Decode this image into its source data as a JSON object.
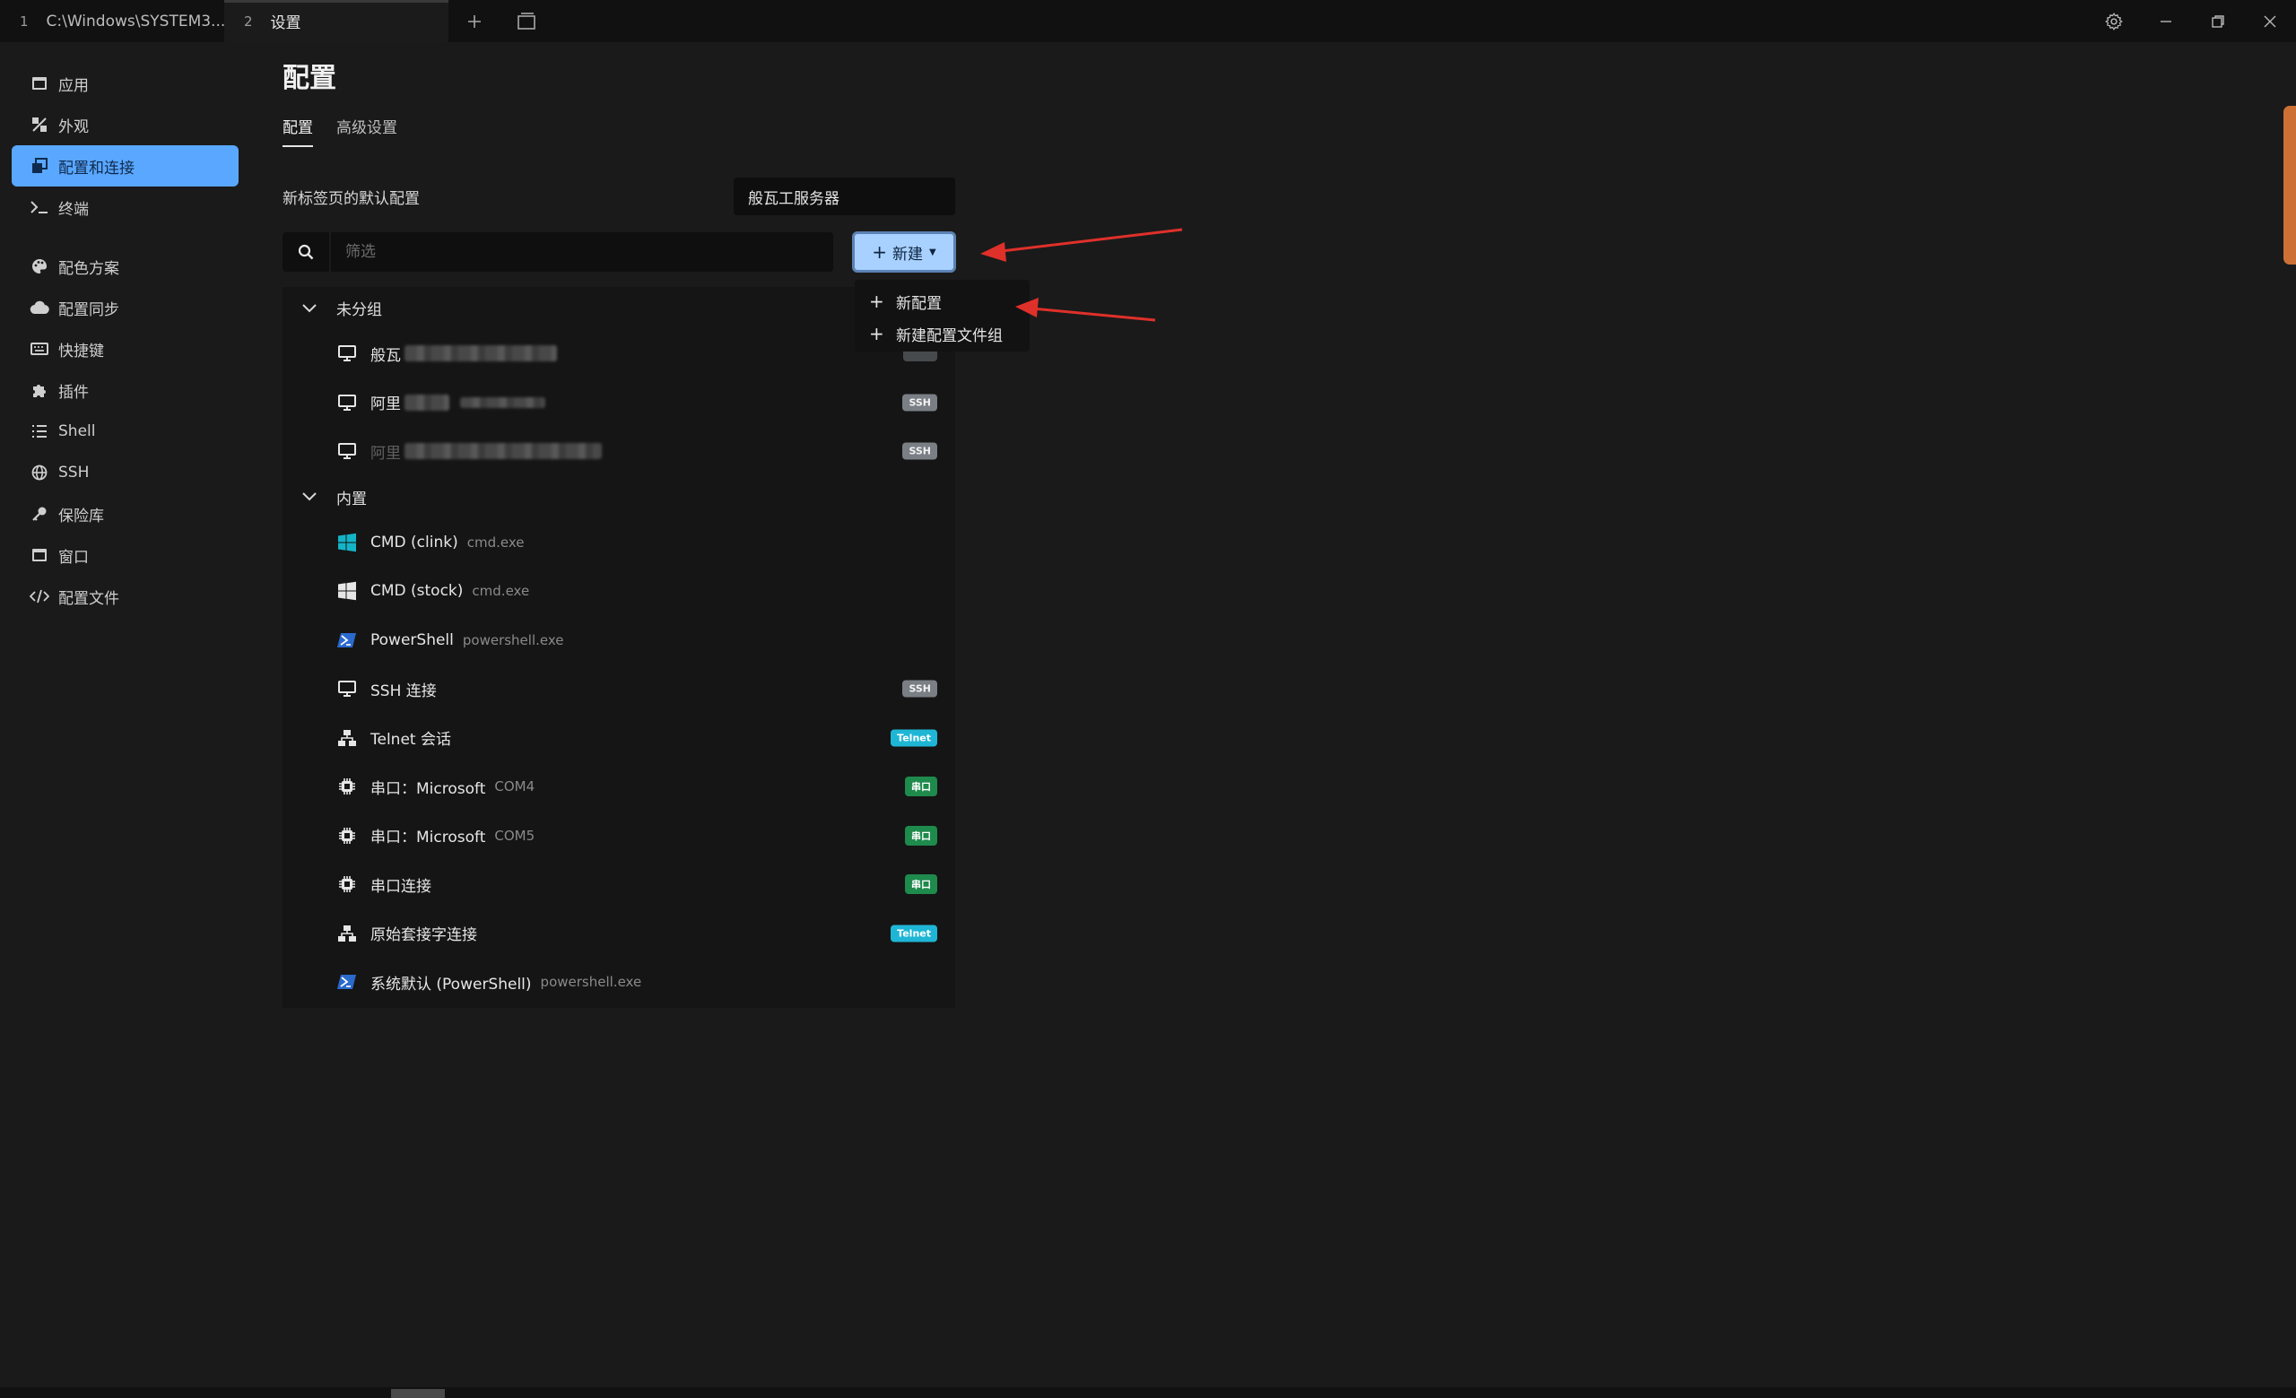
{
  "tabs": [
    {
      "num": "1",
      "label": "C:\\Windows\\SYSTEM3..."
    },
    {
      "num": "2",
      "label": "设置"
    }
  ],
  "sidebar": {
    "items": [
      {
        "label": "应用",
        "icon": "window-icon"
      },
      {
        "label": "外观",
        "icon": "appearance-icon"
      },
      {
        "label": "配置和连接",
        "icon": "profiles-icon"
      },
      {
        "label": "终端",
        "icon": "terminal-icon"
      },
      {
        "label": "配色方案",
        "icon": "palette-icon"
      },
      {
        "label": "配置同步",
        "icon": "cloud-icon"
      },
      {
        "label": "快捷键",
        "icon": "keyboard-icon"
      },
      {
        "label": "插件",
        "icon": "puzzle-icon"
      },
      {
        "label": "Shell",
        "icon": "list-icon"
      },
      {
        "label": "SSH",
        "icon": "globe-icon"
      },
      {
        "label": "保险库",
        "icon": "key-icon"
      },
      {
        "label": "窗口",
        "icon": "window-icon"
      },
      {
        "label": "配置文件",
        "icon": "code-icon"
      }
    ]
  },
  "main": {
    "title": "配置",
    "subtabs": [
      "配置",
      "高级设置"
    ],
    "default_label": "新标签页的默认配置",
    "default_value": "般瓦工服务器",
    "filter_placeholder": "筛选",
    "new_button": "新建",
    "dropdown": [
      "新配置",
      "新建配置文件组"
    ]
  },
  "groups": [
    {
      "title": "未分组",
      "items": [
        {
          "name": "般瓦",
          "cmd": "",
          "badge": "",
          "badge_type": "ssh",
          "icon": "monitor-icon"
        },
        {
          "name": "阿里",
          "cmd": "",
          "badge": "SSH",
          "badge_type": "ssh",
          "icon": "monitor-icon"
        },
        {
          "name": "阿里",
          "cmd": "",
          "badge": "SSH",
          "badge_type": "ssh",
          "icon": "monitor-icon"
        }
      ]
    },
    {
      "title": "内置",
      "items": [
        {
          "name": "CMD (clink)",
          "cmd": "cmd.exe",
          "badge": "",
          "icon": "windows-teal-icon"
        },
        {
          "name": "CMD (stock)",
          "cmd": "cmd.exe",
          "badge": "",
          "icon": "windows-white-icon"
        },
        {
          "name": "PowerShell",
          "cmd": "powershell.exe",
          "badge": "",
          "icon": "powershell-icon"
        },
        {
          "name": "SSH 连接",
          "cmd": "",
          "badge": "SSH",
          "badge_type": "ssh",
          "icon": "monitor-icon"
        },
        {
          "name": "Telnet 会话",
          "cmd": "",
          "badge": "Telnet",
          "badge_type": "telnet",
          "icon": "network-icon"
        },
        {
          "name": "串口：Microsoft",
          "cmd": "COM4",
          "badge": "串口",
          "badge_type": "serial",
          "icon": "chip-icon"
        },
        {
          "name": "串口：Microsoft",
          "cmd": "COM5",
          "badge": "串口",
          "badge_type": "serial",
          "icon": "chip-icon"
        },
        {
          "name": "串口连接",
          "cmd": "",
          "badge": "串口",
          "badge_type": "serial",
          "icon": "chip-icon"
        },
        {
          "name": "原始套接字连接",
          "cmd": "",
          "badge": "Telnet",
          "badge_type": "telnet",
          "icon": "network-icon"
        },
        {
          "name": "系统默认 (PowerShell)",
          "cmd": "powershell.exe",
          "badge": "",
          "icon": "powershell-icon"
        }
      ]
    }
  ],
  "colors": {
    "accent": "#5aa7ff",
    "new_button_bg": "#a9d1ff",
    "annotation_arrow": "#e0302a",
    "ssh_badge": "#7a7f85",
    "telnet_badge": "#1fb6d6",
    "serial_badge": "#1e8a4c"
  }
}
